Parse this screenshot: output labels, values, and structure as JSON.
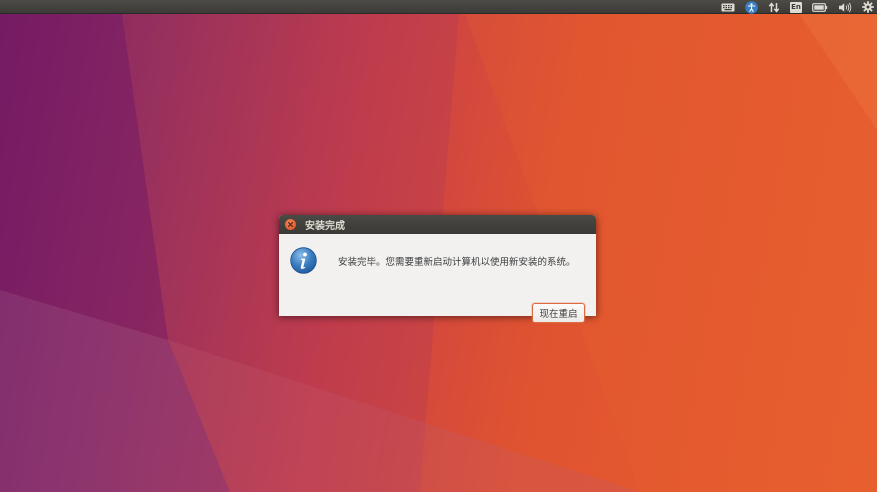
{
  "panel": {
    "language_indicator": "En",
    "icons": [
      "keyboard-icon",
      "accessibility-icon",
      "network-icon",
      "language-icon",
      "battery-icon",
      "volume-icon",
      "settings-gear-icon"
    ]
  },
  "dialog": {
    "title": "安装完成",
    "message": "安装完毕。您需要重新启动计算机以使用新安装的系统。",
    "restart_button_label": "现在重启",
    "icon": "info-icon"
  },
  "colors": {
    "panel_bg": "#3c3b37",
    "dialog_bg": "#f2f1f0",
    "close_button": "#df4a16",
    "button_focus_border": "#e06a40",
    "info_icon": "#3a7cc1"
  }
}
